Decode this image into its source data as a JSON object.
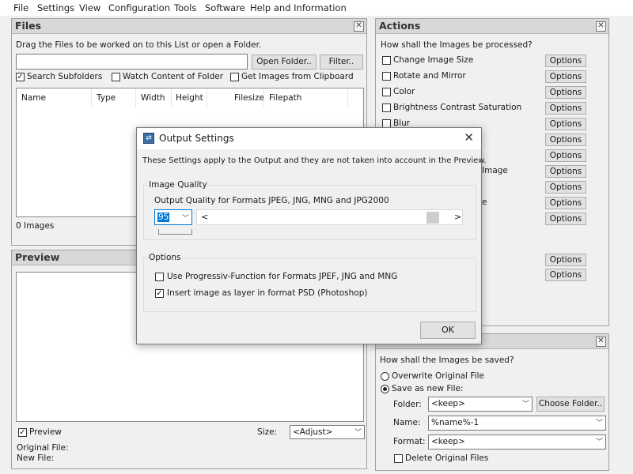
{
  "menu": [
    "File",
    "Settings",
    "View",
    "Configuration",
    "Tools",
    "Software",
    "Help and Information"
  ],
  "files_panel": {
    "title": "Files",
    "instruction": "Drag the Files to be worked on to this List or open a Folder.",
    "path_value": "",
    "open_folder": "Open Folder..",
    "filter": "Filter..",
    "search_subfolders": "Search Subfolders",
    "watch_content": "Watch Content of Folder",
    "get_clipboard": "Get Images from Clipboard",
    "columns": [
      "Name",
      "Type",
      "Width",
      "Height",
      "Filesize",
      "Filepath"
    ],
    "count": "0 Images"
  },
  "actions_panel": {
    "title": "Actions",
    "question": "How shall the Images be processed?",
    "items": [
      "Change Image Size",
      "Rotate and Mirror",
      "Color",
      "Brightness Contrast Saturation",
      "Blur",
      "",
      "",
      "Image",
      "",
      "e",
      ""
    ],
    "options_label": "Options"
  },
  "preview_panel": {
    "title": "Preview",
    "preview_check": "Preview",
    "size_label": "Size:",
    "size_value": "<Adjust>",
    "original_file": "Original File:",
    "new_file": "New File:"
  },
  "save_panel": {
    "question": "How shall the Images be saved?",
    "overwrite": "Overwrite Original File",
    "save_new": "Save as new File:",
    "folder_label": "Folder:",
    "folder_value": "<keep>",
    "choose_folder": "Choose Folder..",
    "name_label": "Name:",
    "name_value": "%name%-1",
    "format_label": "Format:",
    "format_value": "<keep>",
    "delete_original": "Delete Original Files"
  },
  "dialog": {
    "title": "Output Settings",
    "close": "✕",
    "note": "These Settings apply to the Output and they are not taken into account in the Preview.",
    "image_quality_group": "Image Quality",
    "quality_label": "Output Quality for Formats JPEG, JNG, MNG and JPG2000",
    "quality_value": "95",
    "scroll_left": "<",
    "scroll_right": ">",
    "options_group": "Options",
    "opt_progressive": "Use Progressiv-Function for Formats JPEF, JNG and MNG",
    "opt_psd": "Insert image as layer in format PSD (Photoshop)",
    "ok": "OK"
  }
}
